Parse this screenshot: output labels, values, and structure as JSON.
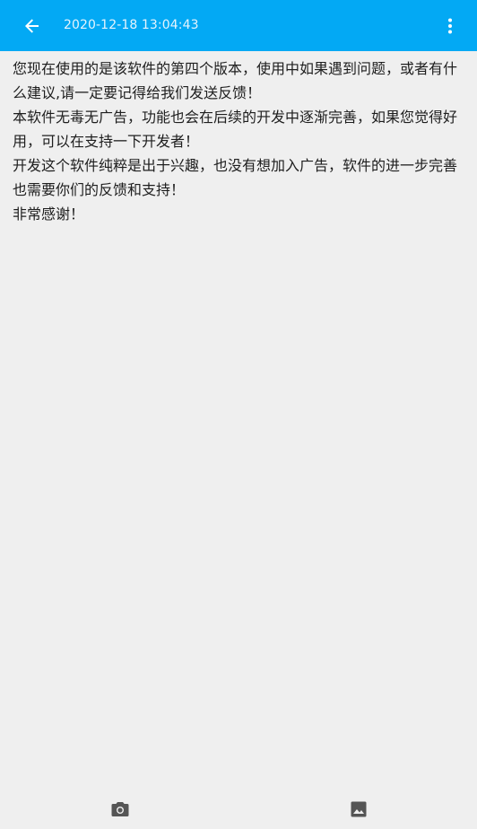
{
  "toolbar": {
    "title": "2020-12-18 13:04:43",
    "back_icon": "arrow-back-icon",
    "menu_icon": "more-vert-icon",
    "background_color": "#03a9f4"
  },
  "note": {
    "paragraphs": [
      "您现在使用的是该软件的第四个版本，使用中如果遇到问题，或者有什么建议,请一定要记得给我们发送反馈！",
      "本软件无毒无广告，功能也会在后续的开发中逐渐完善，如果您觉得好用，可以在支持一下开发者！",
      "开发这个软件纯粹是出于兴趣，也没有想加入广告，软件的进一步完善也需要你们的反馈和支持！",
      "非常感谢！"
    ]
  },
  "bottom_bar": {
    "camera_icon": "camera-icon",
    "image_icon": "image-icon"
  }
}
